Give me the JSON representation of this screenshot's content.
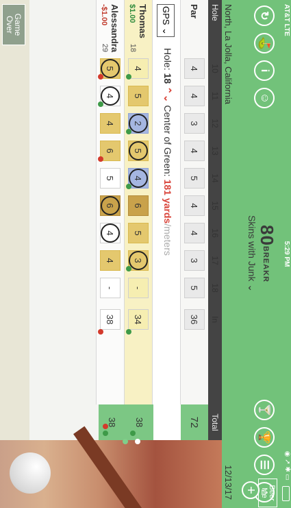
{
  "status": {
    "carrier": "AT&T  LTE",
    "time": "5:29 PM",
    "signal": "◉ ➚ ✱ ▭"
  },
  "header": {
    "logo_number": "80",
    "logo_word": "BREAKR",
    "game": "Skins with Junk ⌄",
    "icons_left": [
      "↻",
      "⛳",
      "i",
      "☺"
    ],
    "icons_right": [
      "🍸",
      "🏆",
      "☰",
      "⌂"
    ]
  },
  "course": {
    "location": "North, La Jolla, California",
    "date": "12/13/17"
  },
  "table": {
    "hole_label": "Hole",
    "holes": [
      "10",
      "11",
      "12",
      "13",
      "14",
      "15",
      "16",
      "17",
      "18"
    ],
    "in_label": "In",
    "total_label": "Total",
    "par_label": "Par",
    "par": [
      "4",
      "4",
      "3",
      "4",
      "5",
      "4",
      "4",
      "3",
      "5"
    ],
    "par_in": "36",
    "par_total": "72"
  },
  "gps": {
    "button": "GPS ⌄",
    "hole_prefix": "Hole:",
    "hole_number": "18",
    "arrows": "⌃⌄",
    "center_prefix": "Center of Green:",
    "distance": "181",
    "yards": "yards",
    "slash": "/",
    "meters": "meters"
  },
  "players": [
    {
      "name": "Thomas",
      "money": "$1.00",
      "handicap": "18",
      "scores": [
        "4",
        "5",
        "2",
        "5",
        "4",
        "6",
        "5",
        "3",
        "-"
      ],
      "in": "34",
      "total": "38"
    },
    {
      "name": "Alessandra",
      "money": "-$1.00",
      "handicap": "29",
      "scores": [
        "5",
        "4",
        "4",
        "6",
        "5",
        "6",
        "4",
        "4",
        "-"
      ],
      "in": "38",
      "total": "38"
    }
  ],
  "buttons": {
    "game_over": "Game Over",
    "beer_me": "Beer Me",
    "add": "+"
  }
}
